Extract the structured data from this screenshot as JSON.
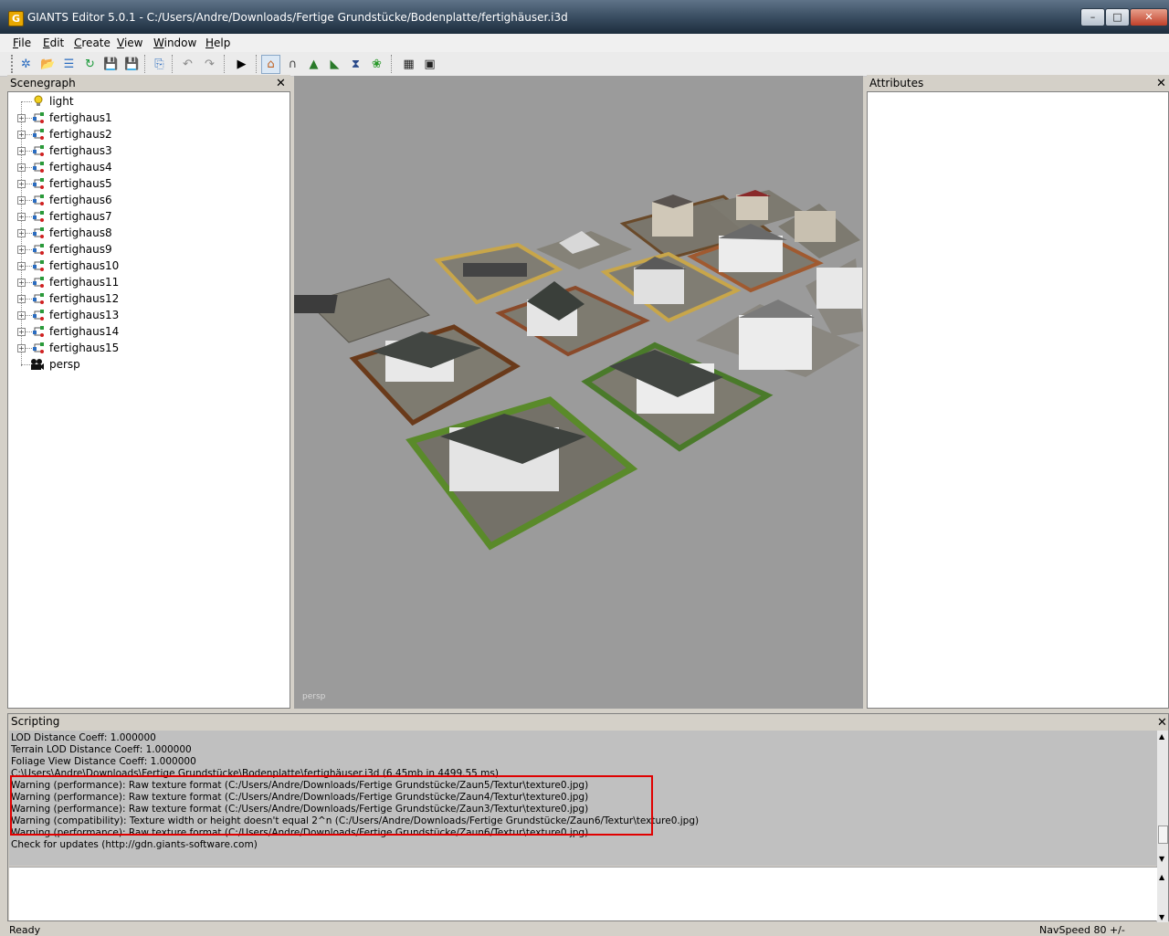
{
  "window": {
    "title": "GIANTS Editor 5.0.1 - C:/Users/Andre/Downloads/Fertige Grundstücke/Bodenplatte/fertighäuser.i3d",
    "icon_letter": "G",
    "buttons": [
      "–",
      "□",
      "✕"
    ]
  },
  "menu": {
    "items": [
      {
        "key": "F",
        "rest": "ile"
      },
      {
        "key": "E",
        "rest": "dit"
      },
      {
        "key": "C",
        "rest": "reate"
      },
      {
        "key": "V",
        "rest": "iew"
      },
      {
        "key": "W",
        "rest": "indow"
      },
      {
        "key": "H",
        "rest": "elp"
      }
    ]
  },
  "toolbar": {
    "icons": [
      "new-icon",
      "open-icon",
      "open-list-icon",
      "refresh-icon",
      "save-icon",
      "save-all-icon",
      "import-icon",
      "undo-icon",
      "redo-icon",
      "play-icon",
      "select-tool-icon",
      "magnet-icon",
      "terrain-paint-icon",
      "terrain-sculpt-icon",
      "terrain-level-icon",
      "foliage-paint-icon",
      "checker-icon",
      "checker-zoom-icon"
    ],
    "glyphs": [
      "✲",
      "📂",
      "☰",
      "↻",
      "💾",
      "💾",
      "⎘",
      "↶",
      "↷",
      "▶",
      "⌂",
      "∩",
      "▲",
      "◣",
      "⧗",
      "❀",
      "▦",
      "▣"
    ]
  },
  "scenegraph": {
    "title": "Scenegraph",
    "close": "✕",
    "nodes": [
      {
        "label": "light",
        "type": "light"
      },
      {
        "label": "fertighaus1",
        "type": "group"
      },
      {
        "label": "fertighaus2",
        "type": "group"
      },
      {
        "label": "fertighaus3",
        "type": "group"
      },
      {
        "label": "fertighaus4",
        "type": "group"
      },
      {
        "label": "fertighaus5",
        "type": "group"
      },
      {
        "label": "fertighaus6",
        "type": "group"
      },
      {
        "label": "fertighaus7",
        "type": "group"
      },
      {
        "label": "fertighaus8",
        "type": "group"
      },
      {
        "label": "fertighaus9",
        "type": "group"
      },
      {
        "label": "fertighaus10",
        "type": "group"
      },
      {
        "label": "fertighaus11",
        "type": "group"
      },
      {
        "label": "fertighaus12",
        "type": "group"
      },
      {
        "label": "fertighaus13",
        "type": "group"
      },
      {
        "label": "fertighaus14",
        "type": "group"
      },
      {
        "label": "fertighaus15",
        "type": "group"
      },
      {
        "label": "persp",
        "type": "camera"
      }
    ]
  },
  "viewport": {
    "camera_label": "persp",
    "background": "#9b9b9b"
  },
  "attributes": {
    "title": "Attributes",
    "close": "✕"
  },
  "scripting": {
    "title": "Scripting",
    "close": "✕",
    "lines": [
      " LOD Distance Coeff: 1.000000",
      " Terrain LOD Distance Coeff: 1.000000",
      " Foliage View Distance Coeff: 1.000000",
      "C:\\Users\\Andre\\Downloads\\Fertige Grundstücke\\Bodenplatte\\fertighäuser.i3d (6.45mb in 4499.55 ms)",
      "Warning (performance): Raw texture format (C:/Users/Andre/Downloads/Fertige Grundstücke/Zaun5/Textur\\texture0.jpg)",
      "Warning (performance): Raw texture format (C:/Users/Andre/Downloads/Fertige Grundstücke/Zaun4/Textur\\texture0.jpg)",
      "Warning (performance): Raw texture format (C:/Users/Andre/Downloads/Fertige Grundstücke/Zaun3/Textur\\texture0.jpg)",
      "Warning (compatibility): Texture width or height doesn't equal 2^n (C:/Users/Andre/Downloads/Fertige Grundstücke/Zaun6/Textur\\texture0.jpg)",
      "Warning (performance): Raw texture format (C:/Users/Andre/Downloads/Fertige Grundstücke/Zaun6/Textur\\texture0.jpg)",
      "Check for updates (http://gdn.giants-software.com)"
    ],
    "highlight_color": "#e00000"
  },
  "status": {
    "left": "Ready",
    "right": "NavSpeed 80 +/-"
  }
}
